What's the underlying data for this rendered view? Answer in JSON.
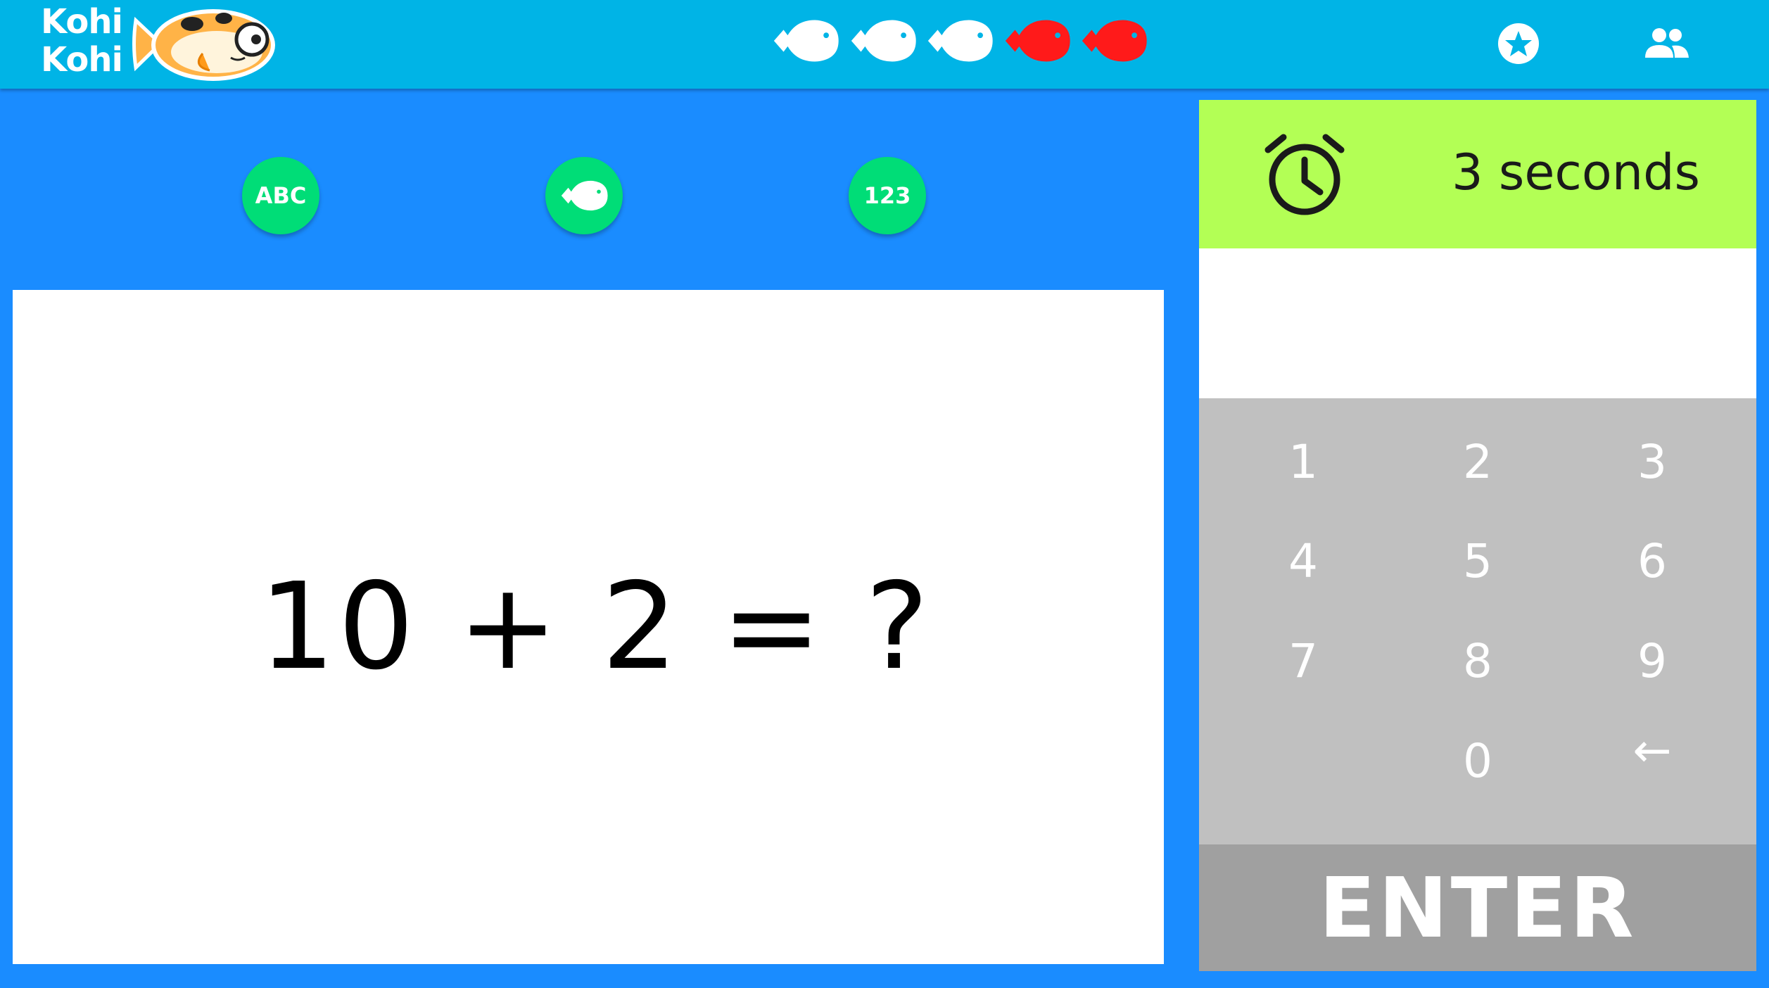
{
  "app": {
    "logo_line1": "Kohi",
    "logo_line2": "Kohi"
  },
  "header": {
    "lives": [
      {
        "state": "remaining",
        "color": "#ffffff",
        "icon": "fish-icon"
      },
      {
        "state": "remaining",
        "color": "#ffffff",
        "icon": "fish-icon"
      },
      {
        "state": "remaining",
        "color": "#ffffff",
        "icon": "fish-icon"
      },
      {
        "state": "lost",
        "color": "#ff1a1a",
        "icon": "fish-icon"
      },
      {
        "state": "lost",
        "color": "#ff1a1a",
        "icon": "fish-icon"
      }
    ],
    "icons": [
      "star-icon",
      "people-icon"
    ]
  },
  "modes": {
    "abc_label": "ABC",
    "fish_icon": "fish-icon",
    "num_label": "123"
  },
  "question": {
    "text": "10 + 2 = ?"
  },
  "timer": {
    "icon": "alarm-clock-icon",
    "text": "3 seconds"
  },
  "answer": {
    "value": ""
  },
  "keypad": {
    "keys": [
      "1",
      "2",
      "3",
      "4",
      "5",
      "6",
      "7",
      "8",
      "9",
      "0",
      "←"
    ],
    "enter_label": "ENTER"
  },
  "colors": {
    "background": "#1a8cff",
    "topbar": "#00b4e6",
    "mode_button": "#00dd77",
    "timer_bar": "#b3ff55",
    "keypad": "#c0c0c0",
    "enter": "#a0a0a0",
    "lost_life": "#ff1a1a"
  }
}
